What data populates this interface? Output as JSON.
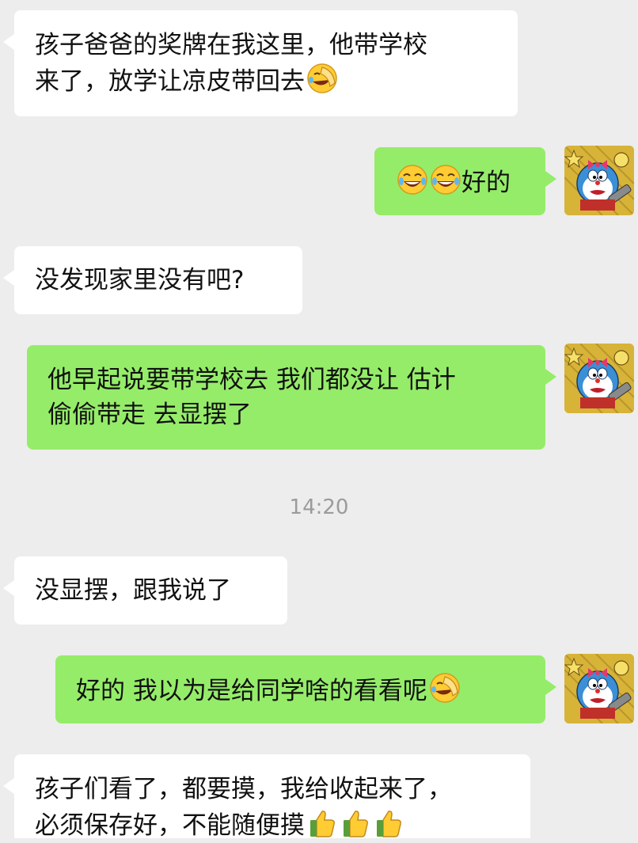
{
  "chat": {
    "messages": [
      {
        "side": "in",
        "lines": [
          "孩子爸爸的奖牌在我这里，他带学校",
          "来了，放学让凉皮带回去"
        ],
        "emojis": [
          "facepalm-laugh"
        ]
      },
      {
        "side": "out",
        "lines": [
          "好的"
        ],
        "emojis_before": [
          "laugh-cry",
          "laugh-cry"
        ]
      },
      {
        "side": "in",
        "lines": [
          "没发现家里没有吧?"
        ]
      },
      {
        "side": "out",
        "lines": [
          "他早起说要带学校去 我们都没让 估计",
          "偷偷带走 去显摆了"
        ]
      },
      {
        "side": "in",
        "lines": [
          "没显摆，跟我说了"
        ]
      },
      {
        "side": "out",
        "lines": [
          "好的 我以为是给同学啥的看看呢"
        ],
        "emojis": [
          "facepalm-laugh"
        ]
      },
      {
        "side": "in",
        "lines": [
          "孩子们看了，都要摸，我给收起来了，",
          "必须保存好，不能随便摸"
        ],
        "emojis": [
          "thumbs-up",
          "thumbs-up",
          "thumbs-up"
        ]
      }
    ],
    "timestamp": "14:20"
  },
  "colors": {
    "background": "#ededed",
    "incoming_bubble": "#ffffff",
    "outgoing_bubble": "#95ec69",
    "timestamp_text": "#9b9b9b"
  },
  "avatar": {
    "icon": "doraemon-avatar-icon"
  }
}
